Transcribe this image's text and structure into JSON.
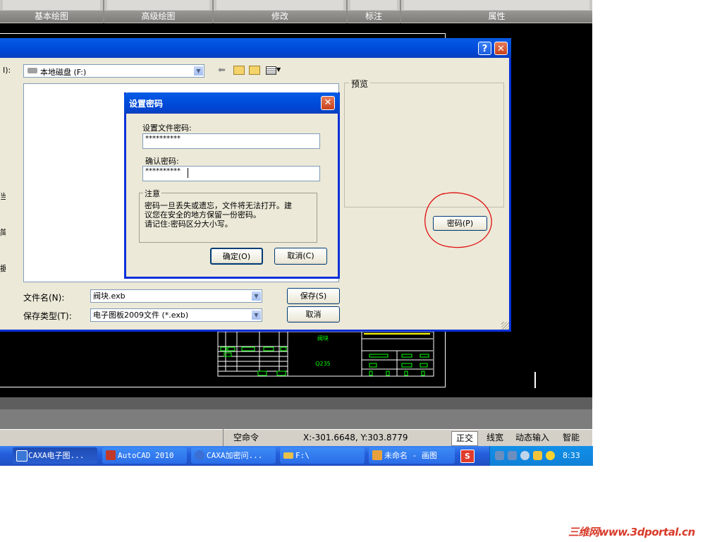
{
  "ribbon": {
    "groups": [
      {
        "label": "基本绘图"
      },
      {
        "label": "高级绘图"
      },
      {
        "label": "修改"
      },
      {
        "label": "标注"
      },
      {
        "label": "属性"
      }
    ]
  },
  "save_dialog": {
    "lookin_label": "I):",
    "lookin_value": "本地磁盘 (F:)",
    "preview_label": "预览",
    "password_button": "密码(P)",
    "filename_label": "文件名(N):",
    "filename_value": "阀块.exb",
    "filetype_label": "保存类型(T):",
    "filetype_value": "电子图板2009文件 (*.exb)",
    "save_button": "保存(S)",
    "cancel_button": "取消",
    "help_glyph": "?",
    "close_glyph": "✕",
    "left_cut_chars": [
      "当",
      "简",
      "据"
    ]
  },
  "password_dialog": {
    "title": "设置密码",
    "close_glyph": "✕",
    "file_password_label": "设置文件密码:",
    "file_password_value": "**********",
    "confirm_label": "确认密码:",
    "confirm_value": "**********",
    "note_label": "注意",
    "note_text": [
      "密码一旦丢失或遗忘，文件将无法打开。建",
      "议您在安全的地方保留一份密码。",
      "请记住:密码区分大小写。"
    ],
    "ok_button": "确定(O)",
    "cancel_button": "取消(C)"
  },
  "drawing": {
    "title_block_name": "阀块",
    "title_block_material": "Q235"
  },
  "status_bar": {
    "command": "空命令",
    "coordinates": "X:-301.6648, Y:303.8779",
    "ortho": "正交",
    "lineweight": "线宽",
    "dynamic_input": "动态输入",
    "smart": "智能"
  },
  "taskbar": {
    "items": [
      {
        "label": "CAXA电子图...",
        "icon": "caxa-icon",
        "color": "#3a78d8"
      },
      {
        "label": "AutoCAD 2010",
        "icon": "autocad-icon",
        "color": "#c0392b"
      },
      {
        "label": "CAXA加密问...",
        "icon": "ie-icon",
        "color": "#3b6fd4"
      },
      {
        "label": "F:\\",
        "icon": "folder-icon",
        "color": "#e8c04a"
      },
      {
        "label": "未命名 - 画图",
        "icon": "paint-icon",
        "color": "#e8a13a"
      }
    ],
    "clock": "8:33"
  },
  "watermark": "三维网www.3dportal.cn",
  "colors": {
    "xp_blue": "#0831d9",
    "dialog_bg": "#ece9d8",
    "annotation_red": "#e01010",
    "cad_green": "#00ff00",
    "cad_yellow": "#ffff00"
  }
}
